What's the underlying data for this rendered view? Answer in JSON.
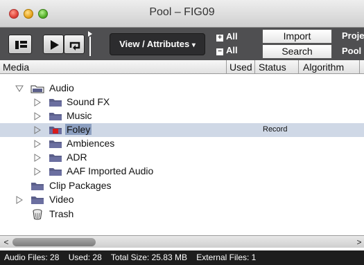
{
  "window": {
    "title": "Pool – FIG09"
  },
  "toolbar": {
    "view_attributes_label": "View / Attributes",
    "expand_all_label": "All",
    "collapse_all_label": "All",
    "import_label": "Import",
    "search_label": "Search",
    "project_label": "Proje",
    "pool_label": "Pool"
  },
  "columns": {
    "media": "Media",
    "used": "Used",
    "status": "Status",
    "algorithm": "Algorithm"
  },
  "tree": {
    "audio": "Audio",
    "sound_fx": "Sound FX",
    "music": "Music",
    "foley": "Foley",
    "foley_status": "Record",
    "ambiences": "Ambiences",
    "adr": "ADR",
    "aaf_imported_audio": "AAF Imported Audio",
    "clip_packages": "Clip Packages",
    "video": "Video",
    "trash": "Trash"
  },
  "statusbar": {
    "audio_files": "Audio Files: 28",
    "used": "Used: 28",
    "total_size": "Total Size: 25.83 MB",
    "external_files": "External Files: 1"
  },
  "colors": {
    "toolbar_bg": "#4f4f51",
    "folder": "#5b5f8a",
    "selection": "#cfd8e6",
    "record_folder": "#d81c1c"
  }
}
